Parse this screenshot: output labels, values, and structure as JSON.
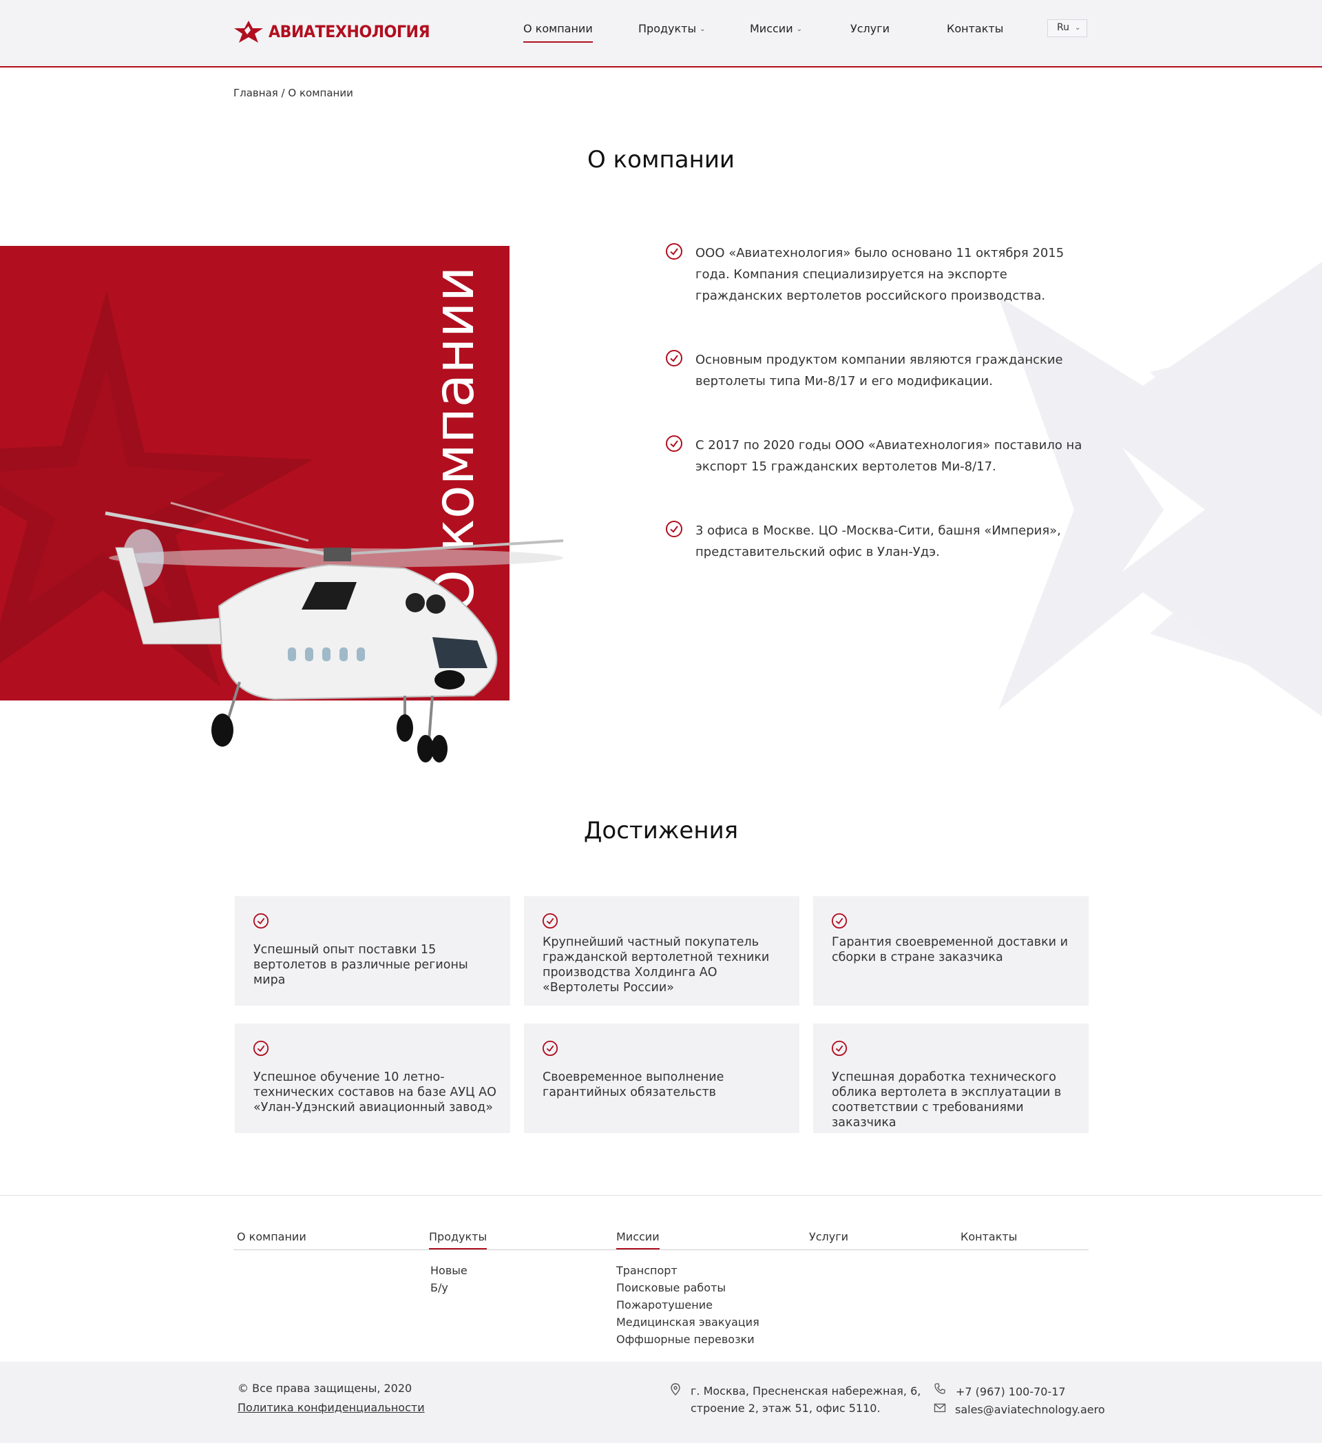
{
  "header": {
    "logo_text": "АВИАТЕХНОЛОГИЯ",
    "nav": [
      {
        "label": "О компании"
      },
      {
        "label": "Продукты"
      },
      {
        "label": "Миссии"
      },
      {
        "label": "Услуги"
      },
      {
        "label": "Контакты"
      }
    ],
    "lang": "Ru"
  },
  "breadcrumb": "Главная / О компании",
  "about": {
    "title": "О компании",
    "vertical_text": "О компании",
    "facts": [
      "ООО «Авиатехнология» было основано 11 октября 2015 года. Компания специализируется на экспорте гражданских вертолетов российского производства.",
      "Основным продуктом компании являются гражданские вертолеты типа Ми-8/17 и его модификации.",
      "С 2017 по 2020 годы ООО «Авиатехнология» поставило на экспорт 15 гражданских вертолетов Ми-8/17.",
      "3 офиса в Москве. ЦО -Москва-Сити, башня «Империя», представительский офис в Улан-Удэ."
    ]
  },
  "achievements": {
    "title": "Достижения",
    "cards": [
      "Успешный опыт поставки 15 вертолетов в различные регионы мира",
      "Крупнейший частный покупатель гражданской вертолетной техники производства Холдинга АО «Вертолеты России»",
      "Гарантия своевременной доставки и сборки в стране заказчика",
      "Успешное обучение 10 летно-технических составов на базе АУЦ АО «Улан-Удэнский авиационный завод»",
      "Своевременное выполнение гарантийных обязательств",
      "Успешная доработка технического облика вертолета в эксплуатации в соответствии с требованиями заказчика"
    ]
  },
  "footer": {
    "columns": [
      {
        "head": "О компании",
        "links": []
      },
      {
        "head": "Продукты",
        "links": [
          "Новые",
          "Б/у"
        ]
      },
      {
        "head": "Миссии",
        "links": [
          "Транспорт",
          "Поисковые работы",
          "Пожаротушение",
          "Медицинская эвакуация",
          "Оффшорные перевозки"
        ]
      },
      {
        "head": "Услуги",
        "links": []
      },
      {
        "head": "Контакты",
        "links": []
      }
    ],
    "copyright": "© Все права защищены, 2020",
    "privacy": "Политика конфиденциальности",
    "address_line1": "г. Москва, Пресненская набережная, 6,",
    "address_line2": "строение 2, этаж 51, офис 5110.",
    "phone": "+7 (967) 100-70-17",
    "email": "sales@aviatechnology.aero"
  },
  "colors": {
    "accent": "#b10f1f",
    "panel": "#f2f2f5",
    "header_bg": "#f3f3f6"
  }
}
